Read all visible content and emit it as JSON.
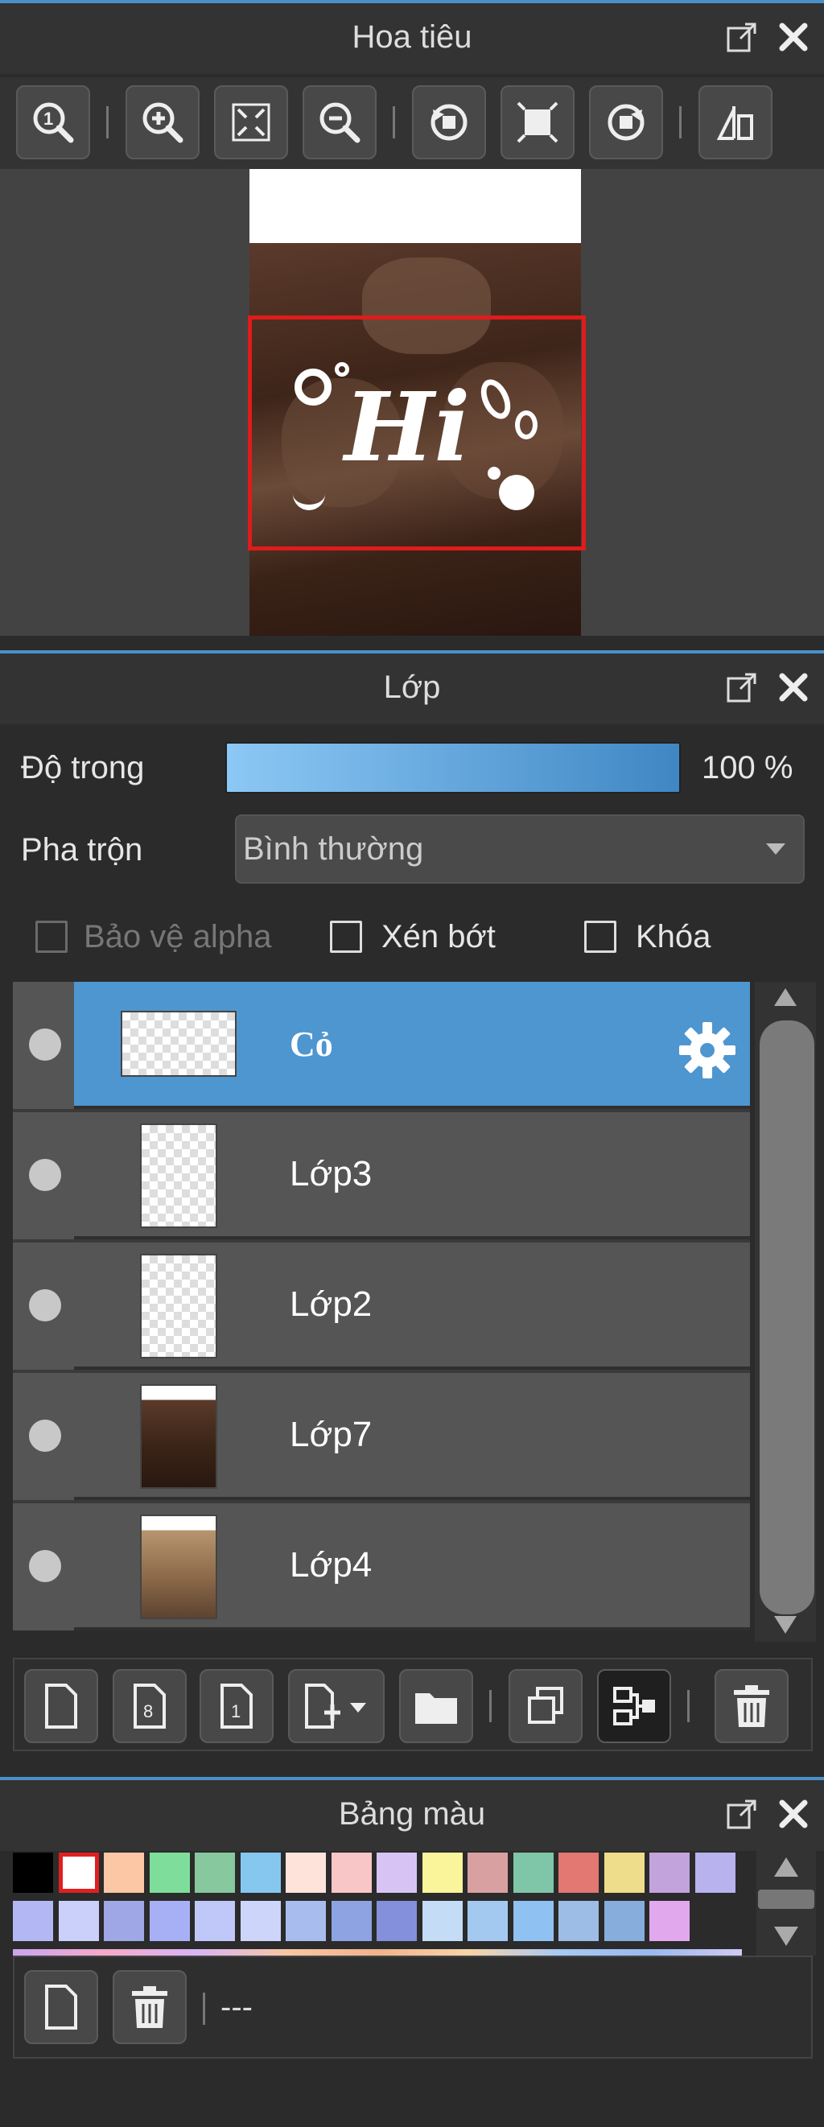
{
  "navigator": {
    "title": "Hoa tiêu",
    "canvas_text": "Hi",
    "tools": [
      {
        "icon": "zoom-actual-icon"
      },
      {
        "icon": "zoom-in-icon"
      },
      {
        "icon": "fit-screen-icon"
      },
      {
        "icon": "zoom-out-icon"
      },
      {
        "icon": "rotate-left-icon"
      },
      {
        "icon": "fit-canvas-icon"
      },
      {
        "icon": "rotate-right-icon"
      },
      {
        "icon": "flip-horizontal-icon"
      }
    ]
  },
  "layers": {
    "title": "Lớp",
    "opacity_label": "Độ trong",
    "opacity_value": "100 %",
    "opacity": 1.0,
    "blend_label": "Pha trộn",
    "blend_value": "Bình thường",
    "protect_alpha": "Bảo vệ alpha",
    "clip": "Xén bớt",
    "lock": "Khóa",
    "items": [
      {
        "name": "Cỏ",
        "selected": true
      },
      {
        "name": "Lớp3",
        "selected": false
      },
      {
        "name": "Lớp2",
        "selected": false
      },
      {
        "name": "Lớp7",
        "selected": false
      },
      {
        "name": "Lớp4",
        "selected": false
      }
    ],
    "actions": [
      "new-layer-icon",
      "new-layer-8bit-icon",
      "new-layer-1bit-icon",
      "add-layer-menu-icon",
      "folder-icon",
      "duplicate-icon",
      "merge-icon",
      "trash-icon"
    ]
  },
  "palette": {
    "title": "Bảng màu",
    "name": "---",
    "row1": [
      "#000000",
      "#ffffff",
      "#fcc7a4",
      "#7edd9a",
      "#88c89e",
      "#86c7f0",
      "#fde3d9",
      "#f8c6c7",
      "#d8c4f4",
      "#faf49b",
      "#d9a0a2",
      "#7fc6a9",
      "#e37771",
      "#eedd8a",
      "#c3a3dc",
      "#b8b2ef"
    ],
    "row2": [
      "#b3b8f5",
      "#cbd0fa",
      "#9fa7e6",
      "#a7b0f4",
      "#c0c8fa",
      "#cdd6fa",
      "#a9bcee",
      "#8da3e2",
      "#8490db",
      "#c4dcf5",
      "#a3c9f1",
      "#8fc2f2",
      "#9dbce6",
      "#86addc",
      "#e1a8ee"
    ]
  }
}
